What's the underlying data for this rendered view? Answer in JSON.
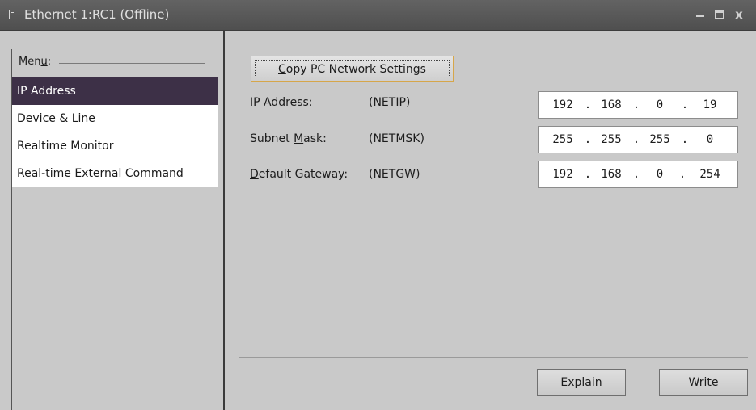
{
  "window": {
    "title": "Ethernet 1:RC1 (Offline)",
    "icon": "document-icon",
    "controls": [
      "minimize-icon",
      "maximize-icon",
      "close-icon"
    ],
    "close_glyph": "x"
  },
  "sidebar": {
    "heading_pre": "Men",
    "heading_ul": "u",
    "heading_post": ":",
    "items": [
      {
        "label": "IP Address",
        "selected": true
      },
      {
        "label": "Device & Line",
        "selected": false
      },
      {
        "label": "Realtime Monitor",
        "selected": false
      },
      {
        "label": "Real-time External Command",
        "selected": false
      }
    ]
  },
  "copy_button": {
    "pre": "",
    "ul": "C",
    "post": "opy PC Network Settings"
  },
  "fields": [
    {
      "label_pre": "",
      "label_ul": "I",
      "label_post": "P Address:",
      "code": "(NETIP)",
      "octets": [
        "192",
        "168",
        "0",
        "19"
      ]
    },
    {
      "label_pre": "Subnet ",
      "label_ul": "M",
      "label_post": "ask:",
      "code": "(NETMSK)",
      "octets": [
        "255",
        "255",
        "255",
        "0"
      ]
    },
    {
      "label_pre": "",
      "label_ul": "D",
      "label_post": "efault Gateway:",
      "code": "(NETGW)",
      "octets": [
        "192",
        "168",
        "0",
        "254"
      ]
    }
  ],
  "dot": ".",
  "footer": {
    "explain": {
      "pre": "",
      "ul": "E",
      "post": "xplain"
    },
    "write": {
      "pre": "W",
      "ul": "r",
      "post": "ite"
    }
  },
  "colors": {
    "selected_bg": "#3d3047",
    "focus_border": "#d6a64a",
    "titlebar": "#585858"
  }
}
